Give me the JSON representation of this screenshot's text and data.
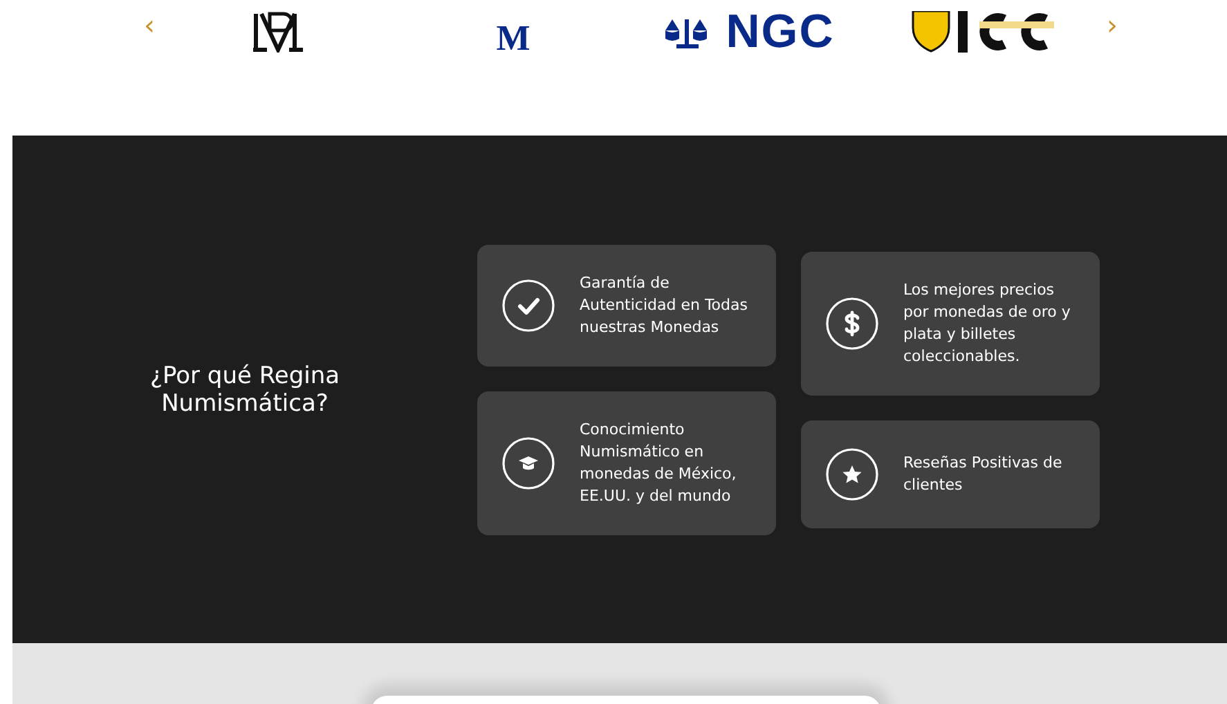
{
  "logo_carousel": {
    "prev": "‹",
    "next": "›",
    "logos": [
      {
        "kind": "monogram"
      },
      {
        "kind": "letter",
        "text": "M"
      },
      {
        "kind": "scales",
        "text": "NGC"
      },
      {
        "kind": "shield"
      }
    ]
  },
  "why_section": {
    "title": "¿Por qué Regina Numismática?",
    "features": [
      {
        "kind": "check",
        "text": "Garantía de Autenticidad en Todas nuestras Monedas"
      },
      {
        "kind": "cap",
        "text": "Conocimiento Numismático en monedas de México, EE.UU. y del mundo"
      },
      {
        "kind": "dollar",
        "text": "Los mejores precios por monedas de oro y plata y billetes coleccionables."
      },
      {
        "kind": "star",
        "text": "Reseñas Positivas de clientes"
      }
    ]
  }
}
